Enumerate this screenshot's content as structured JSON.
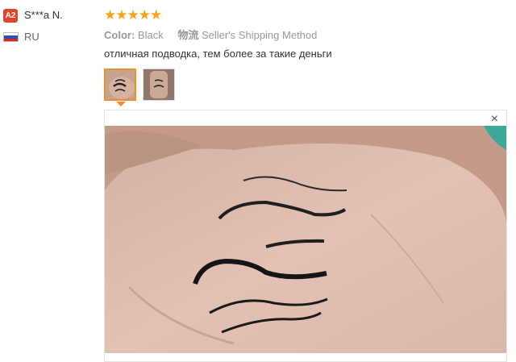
{
  "user": {
    "badge": "A2",
    "name": "S***a N.",
    "country": "RU",
    "flag_icon": "russia-flag-icon"
  },
  "review": {
    "rating": 5,
    "stars_text": "★★★★★",
    "color_label": "Color:",
    "color_value": "Black",
    "shipping_label": "物流",
    "shipping_value": "Seller's Shipping Method",
    "text": "отличная подводка, тем более за такие деньги"
  },
  "images": {
    "thumbnails": [
      "eyeliner-swatch-thumb",
      "hand-swatch-thumb"
    ],
    "selected_index": 0,
    "close_label": "×"
  },
  "colors": {
    "star": "#f7a21b",
    "badge": "#e0452b",
    "thumb_active": "#f08e2b"
  }
}
